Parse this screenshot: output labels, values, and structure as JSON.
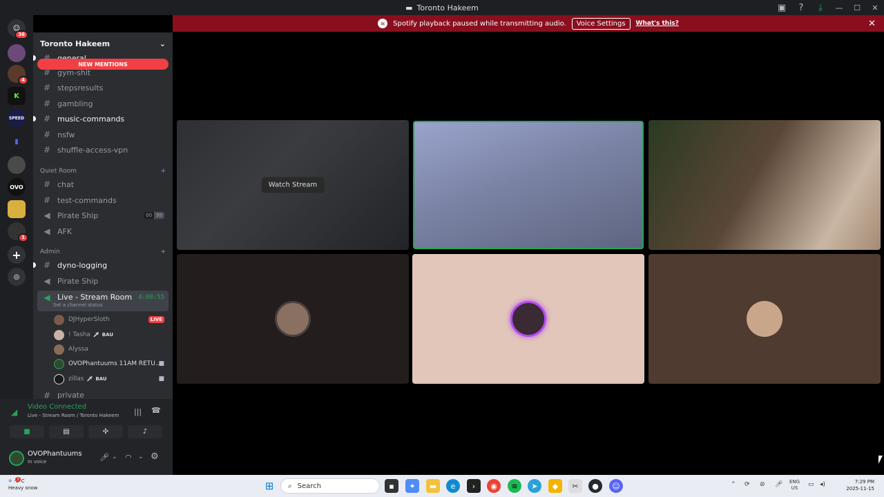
{
  "window": {
    "title": "Toronto Hakeem"
  },
  "notice": {
    "text": "Spotify playback paused while transmitting audio.",
    "button": "Voice Settings",
    "link": "What's this?"
  },
  "servers": [
    {
      "label": "36",
      "kind": "home"
    },
    {
      "label": "",
      "badge": ""
    },
    {
      "label": "",
      "badge": "4"
    },
    {
      "label": "K"
    },
    {
      "label": "SPEED"
    },
    {
      "label": ""
    },
    {
      "label": ""
    },
    {
      "label": "OVO"
    },
    {
      "label": ""
    },
    {
      "label": "",
      "badge": "1"
    }
  ],
  "guild": {
    "name": "Toronto Hakeem",
    "new_mentions": "NEW MENTIONS",
    "channels": [
      {
        "name": "general",
        "type": "text",
        "unread": true
      },
      {
        "name": "gym-shit",
        "type": "text"
      },
      {
        "name": "stepsresults",
        "type": "text"
      },
      {
        "name": "gambling",
        "type": "text"
      },
      {
        "name": "music-commands",
        "type": "text",
        "unread": true
      },
      {
        "name": "nsfw",
        "type": "text"
      },
      {
        "name": "shuffle-access-vpn",
        "type": "text"
      }
    ],
    "category_quiet": "Quiet Room",
    "quiet_channels": [
      {
        "name": "chat",
        "type": "text"
      },
      {
        "name": "test-commands",
        "type": "text"
      },
      {
        "name": "Pirate Ship",
        "type": "voice",
        "count_a": "00",
        "count_b": "99"
      },
      {
        "name": "AFK",
        "type": "voice"
      }
    ],
    "category_admin": "Admin",
    "admin_channels": [
      {
        "name": "dyno-logging",
        "type": "text",
        "unread": true
      },
      {
        "name": "Pirate Ship",
        "type": "voice"
      }
    ],
    "live_room": {
      "name": "Live - Stream Room",
      "timer": "4:08:55",
      "status": "Set a channel status"
    },
    "voice_users": [
      {
        "name": "DJHyperSloth",
        "live": "LIVE",
        "color": "#7a5b4a"
      },
      {
        "name": "! Tasha",
        "tag": "BAU",
        "color": "#c9b3a6"
      },
      {
        "name": "Alyssa",
        "color": "#8a6b5a"
      },
      {
        "name": "OVOPhantuums 11AM RETU...",
        "cam": true,
        "color": "#2f4a2f"
      },
      {
        "name": "zillas",
        "tag": "BAU",
        "cam": true,
        "color": "#1a1a1a"
      }
    ],
    "private": "private"
  },
  "voice": {
    "status": "Video Connected",
    "location": "Live - Stream Room / Toronto Hakeem"
  },
  "user": {
    "name": "OVOPhantuums",
    "status": "In voice"
  },
  "stream": {
    "watch_label": "Watch Stream"
  },
  "tiles_colors": {
    "t4": "#231d1d",
    "t5": "#e2c6ba",
    "t6": "#4f3b2f"
  },
  "taskbar": {
    "search_placeholder": "Search",
    "weather_temp": "-1°C",
    "weather_desc": "Heavy snow",
    "weather_badge": "3",
    "lang_top": "ENG",
    "lang_bottom": "US",
    "time": "7:29 PM",
    "date": "2025-11-15"
  }
}
